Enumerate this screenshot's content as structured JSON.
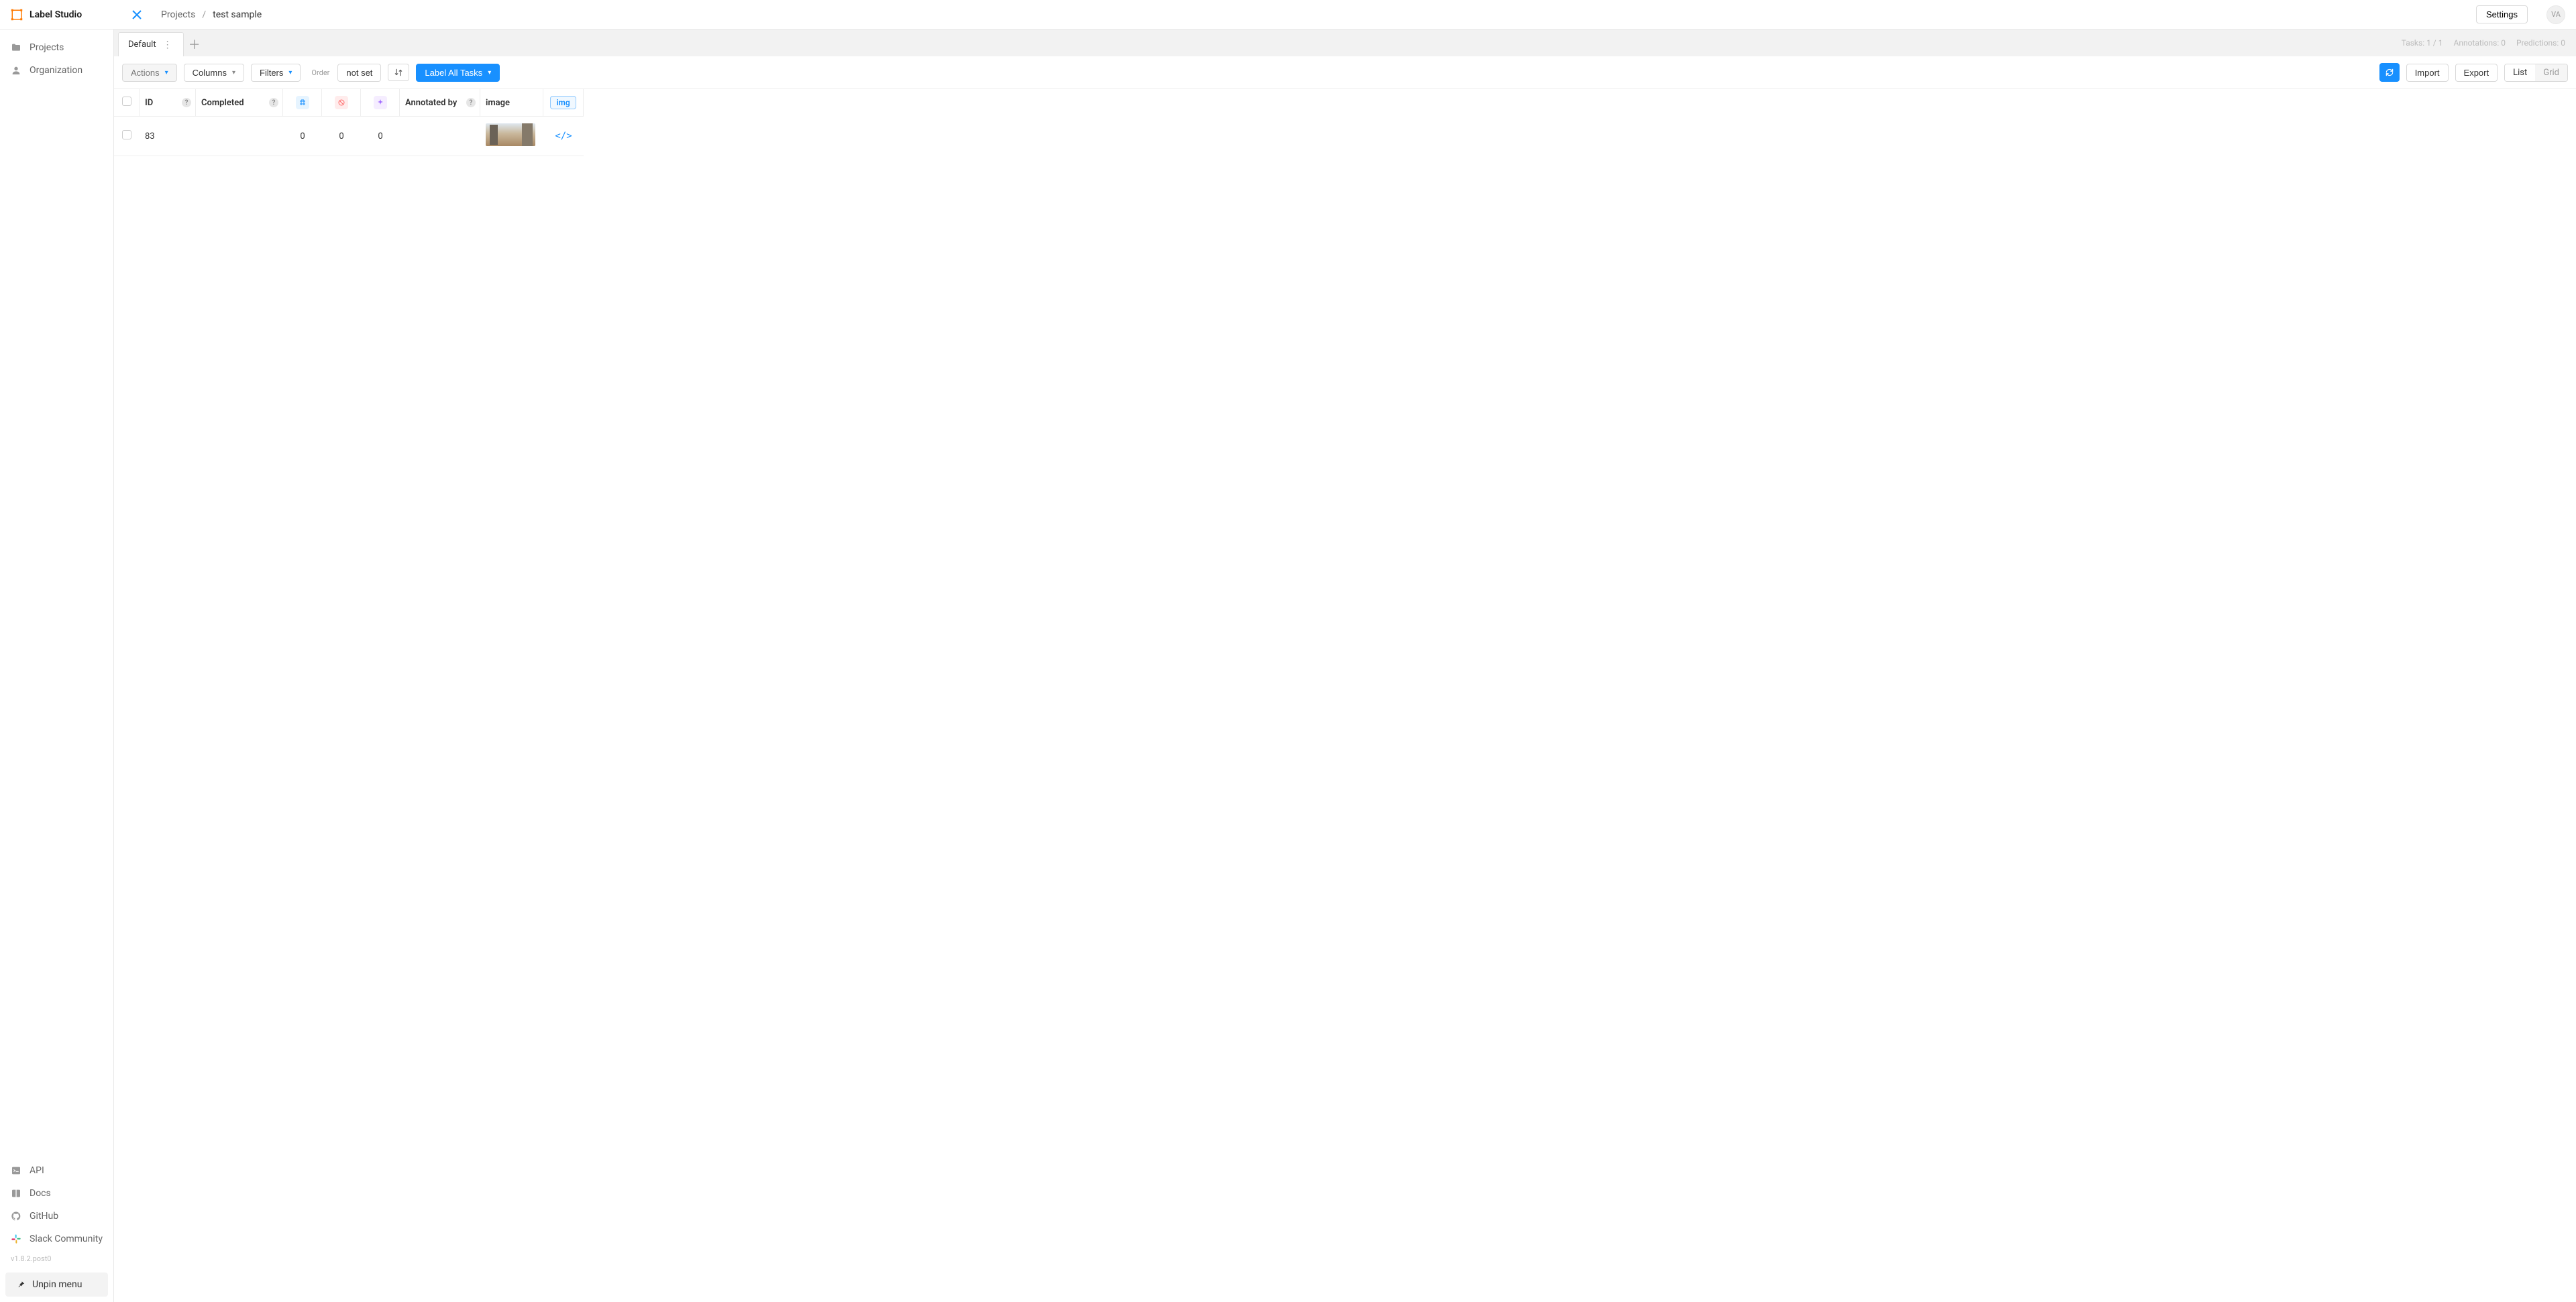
{
  "brand": "Label Studio",
  "breadcrumb": {
    "root": "Projects",
    "current": "test sample"
  },
  "header": {
    "settings": "Settings",
    "avatar_initials": "VA"
  },
  "sidebar": {
    "top": [
      {
        "label": "Projects"
      },
      {
        "label": "Organization"
      }
    ],
    "bottom": [
      {
        "label": "API"
      },
      {
        "label": "Docs"
      },
      {
        "label": "GitHub"
      },
      {
        "label": "Slack Community"
      }
    ],
    "version": "v1.8.2.post0",
    "unpin": "Unpin menu"
  },
  "tabs": {
    "active": "Default"
  },
  "status": {
    "tasks": "Tasks: 1 / 1",
    "annotations": "Annotations: 0",
    "predictions": "Predictions: 0"
  },
  "toolbar": {
    "actions": "Actions",
    "columns": "Columns",
    "filters": "Filters",
    "order_label": "Order",
    "order_value": "not set",
    "label_all": "Label All Tasks",
    "import": "Import",
    "export": "Export",
    "view_list": "List",
    "view_grid": "Grid"
  },
  "columns": {
    "id": "ID",
    "completed": "Completed",
    "annotated_by": "Annotated by",
    "image": "image",
    "img": "img"
  },
  "rows": [
    {
      "id": "83",
      "completed": "",
      "c1": "0",
      "c2": "0",
      "c3": "0",
      "annotated_by": ""
    }
  ]
}
